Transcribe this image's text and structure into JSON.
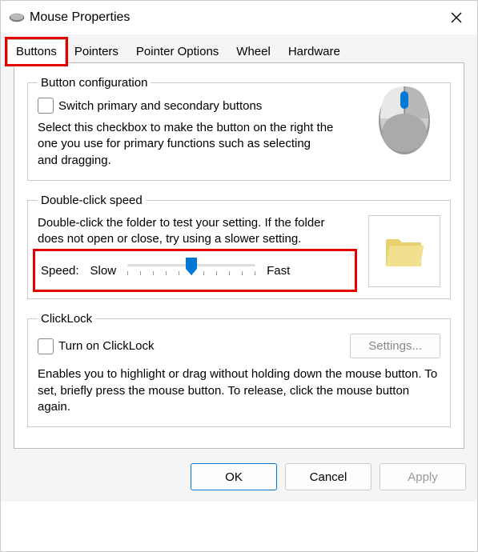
{
  "title": "Mouse Properties",
  "tabs": [
    "Buttons",
    "Pointers",
    "Pointer Options",
    "Wheel",
    "Hardware"
  ],
  "active_tab_index": 0,
  "button_config": {
    "legend": "Button configuration",
    "checkbox_label": "Switch primary and secondary buttons",
    "checked": false,
    "desc": "Select this checkbox to make the button on the right the one you use for primary functions such as selecting and dragging."
  },
  "doubleclick": {
    "legend": "Double-click speed",
    "desc": "Double-click the folder to test your setting. If the folder does not open or close, try using a slower setting.",
    "speed_label": "Speed:",
    "slow_label": "Slow",
    "fast_label": "Fast",
    "slider_value": 5,
    "slider_min": 0,
    "slider_max": 10
  },
  "clicklock": {
    "legend": "ClickLock",
    "checkbox_label": "Turn on ClickLock",
    "checked": false,
    "settings_label": "Settings...",
    "settings_enabled": false,
    "desc": "Enables you to highlight or drag without holding down the mouse button. To set, briefly press the mouse button. To release, click the mouse button again."
  },
  "footer": {
    "ok": "OK",
    "cancel": "Cancel",
    "apply": "Apply",
    "apply_enabled": false
  }
}
